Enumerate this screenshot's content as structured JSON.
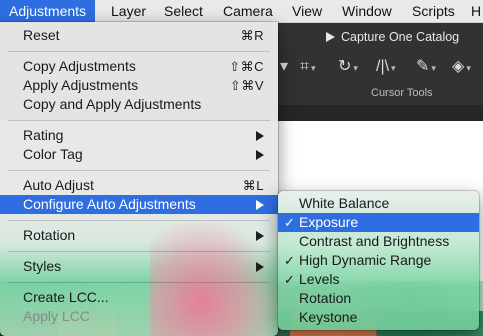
{
  "menubar": {
    "items": [
      {
        "label": "Adjustments",
        "active": true
      },
      {
        "label": "Layer"
      },
      {
        "label": "Select"
      },
      {
        "label": "Camera"
      },
      {
        "label": "View"
      },
      {
        "label": "Window"
      },
      {
        "label": "Scripts"
      },
      {
        "label": "H"
      }
    ]
  },
  "app": {
    "document_title": "Capture One Catalog",
    "cursor_tools_label": "Cursor Tools"
  },
  "adjustments_menu": {
    "reset": {
      "label": "Reset",
      "shortcut": "⌘R"
    },
    "copy_adjustments": {
      "label": "Copy Adjustments",
      "shortcut": "⇧⌘C"
    },
    "apply_adjustments": {
      "label": "Apply Adjustments",
      "shortcut": "⇧⌘V"
    },
    "copy_and_apply": {
      "label": "Copy and Apply Adjustments"
    },
    "rating": {
      "label": "Rating"
    },
    "color_tag": {
      "label": "Color Tag"
    },
    "auto_adjust": {
      "label": "Auto Adjust",
      "shortcut": "⌘L"
    },
    "configure_auto": {
      "label": "Configure Auto Adjustments",
      "highlighted": true
    },
    "rotation": {
      "label": "Rotation"
    },
    "styles": {
      "label": "Styles"
    },
    "create_lcc": {
      "label": "Create LCC..."
    },
    "apply_lcc": {
      "label": "Apply LCC",
      "disabled": true
    }
  },
  "configure_submenu": {
    "items": [
      {
        "label": "White Balance",
        "checked": false
      },
      {
        "label": "Exposure",
        "checked": true,
        "highlighted": true
      },
      {
        "label": "Contrast and Brightness",
        "checked": false
      },
      {
        "label": "High Dynamic Range",
        "checked": true
      },
      {
        "label": "Levels",
        "checked": true
      },
      {
        "label": "Rotation",
        "checked": false
      },
      {
        "label": "Keystone",
        "checked": false
      }
    ],
    "check_glyph": "✓"
  },
  "colors": {
    "highlight": "#2f6ee0",
    "menubar_bg": "#e9e9e9",
    "toolbar_bg": "#323232"
  }
}
